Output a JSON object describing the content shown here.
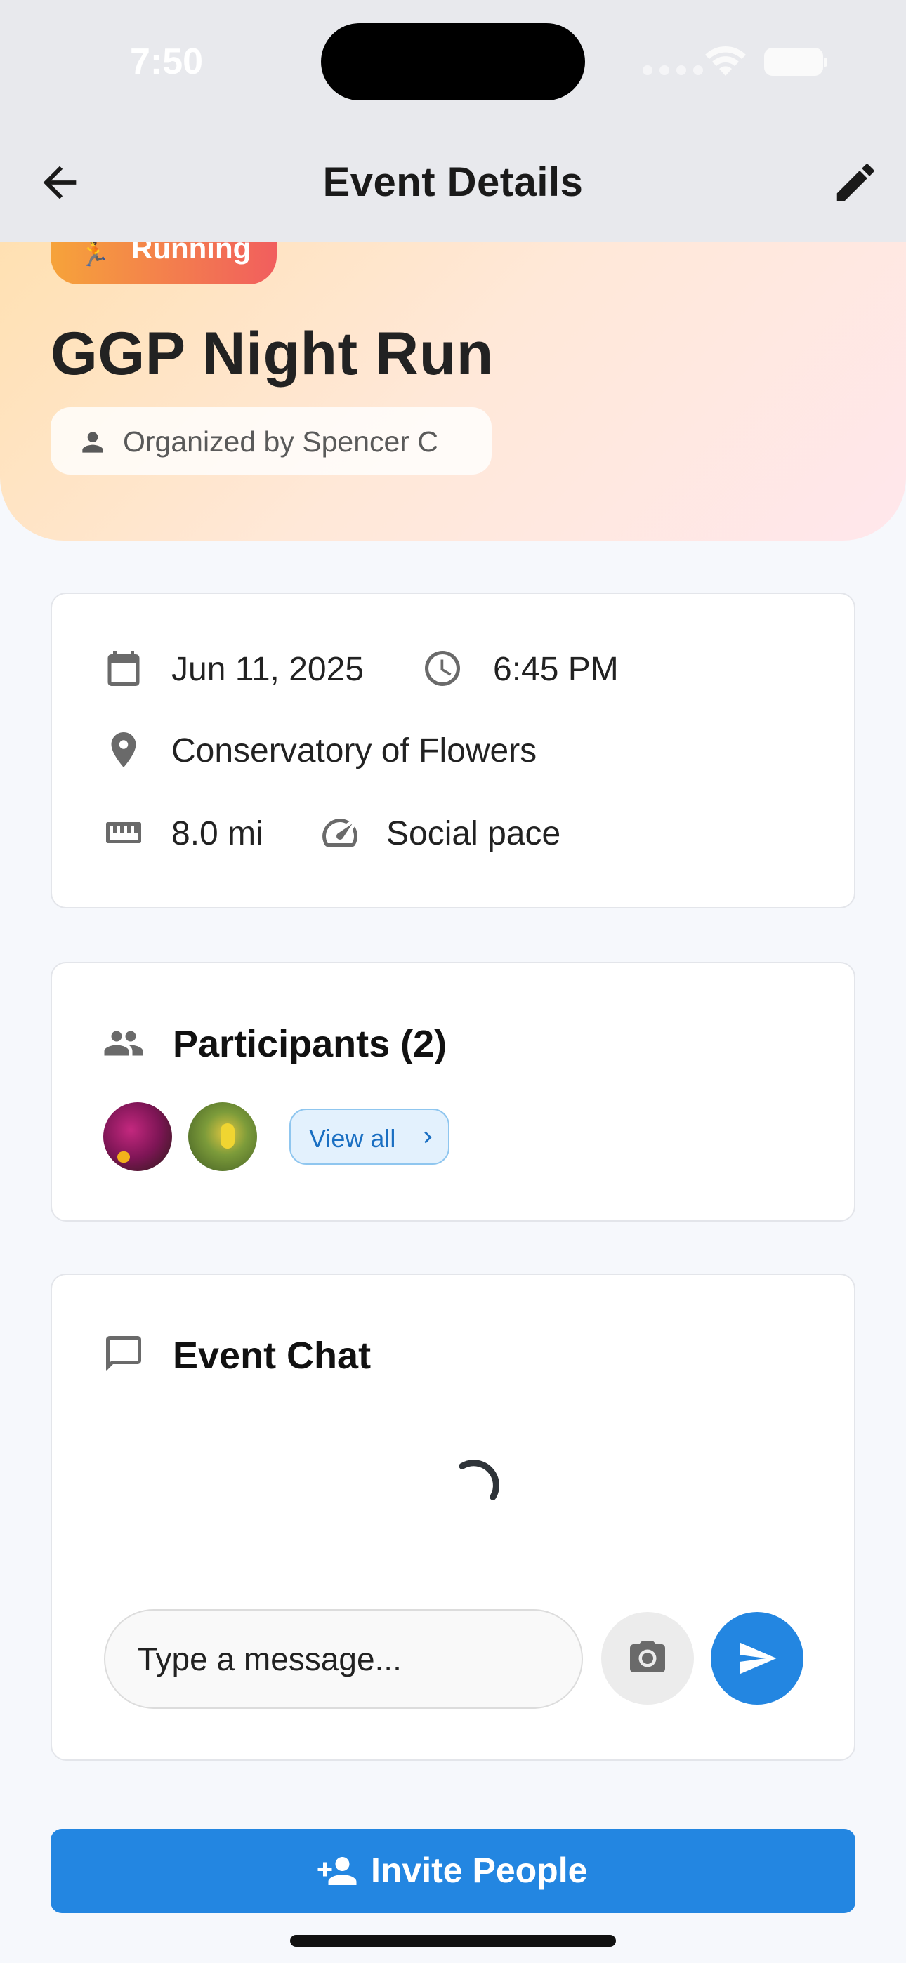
{
  "status_bar": {
    "time": "7:50"
  },
  "header": {
    "title": "Event Details",
    "back_icon": "arrow-left-icon",
    "edit_icon": "pencil-icon"
  },
  "event": {
    "category": "Running",
    "title": "GGP Night Run",
    "organizer": "Organized by Spencer C"
  },
  "details": {
    "date": "Jun 11, 2025",
    "time": "6:45 PM",
    "location": "Conservatory of Flowers",
    "distance": "8.0 mi",
    "pace": "Social pace"
  },
  "participants": {
    "title": "Participants (2)",
    "view_all_label": "View all"
  },
  "chat": {
    "title": "Event Chat",
    "input_placeholder": "Type a message..."
  },
  "actions": {
    "invite_label": "Invite People"
  },
  "colors": {
    "primary": "#2386e1",
    "hero_start": "#ffe0b0",
    "hero_end": "#ffe7ec",
    "pill_start": "#f6a33a",
    "pill_end": "#f15e5e"
  }
}
